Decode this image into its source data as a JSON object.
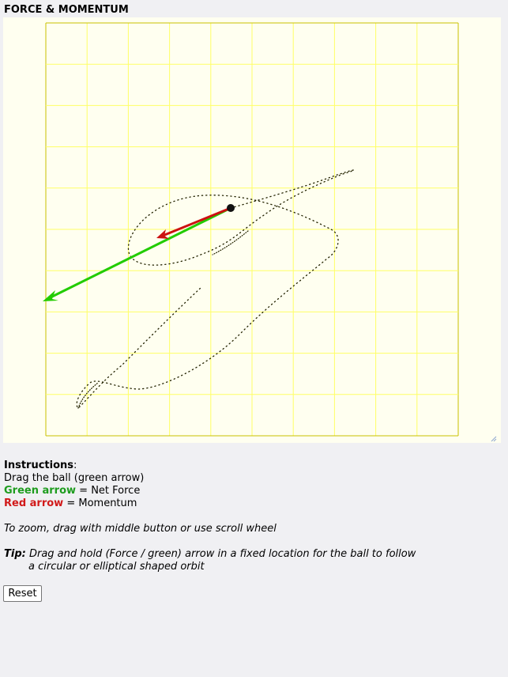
{
  "app": {
    "title": "FORCE & MOMENTUM"
  },
  "colors": {
    "canvas_bg": "#fffff0",
    "grid": "#ffff66",
    "grid_border": "#c8c000",
    "net_force_arrow": "#22cc00",
    "momentum_arrow": "#cc1111",
    "ball": "#111111",
    "trail": "#222200"
  },
  "scene": {
    "grid_cols": 10,
    "grid_rows": 10
  },
  "instructions": {
    "heading": "Instructions",
    "heading_suffix": ":",
    "drag_line": "Drag the ball (green arrow)",
    "green_label": "Green arrow",
    "green_desc": " = Net Force",
    "red_label": "Red arrow",
    "red_desc": " = Momentum",
    "zoom_line": "To zoom, drag with middle button or use scroll wheel",
    "tip_label": "Tip:",
    "tip_line1": " Drag and hold (Force / green) arrow in a fixed location for the ball to follow",
    "tip_line2": "a circular or elliptical shaped orbit"
  },
  "controls": {
    "reset_label": "Reset"
  }
}
